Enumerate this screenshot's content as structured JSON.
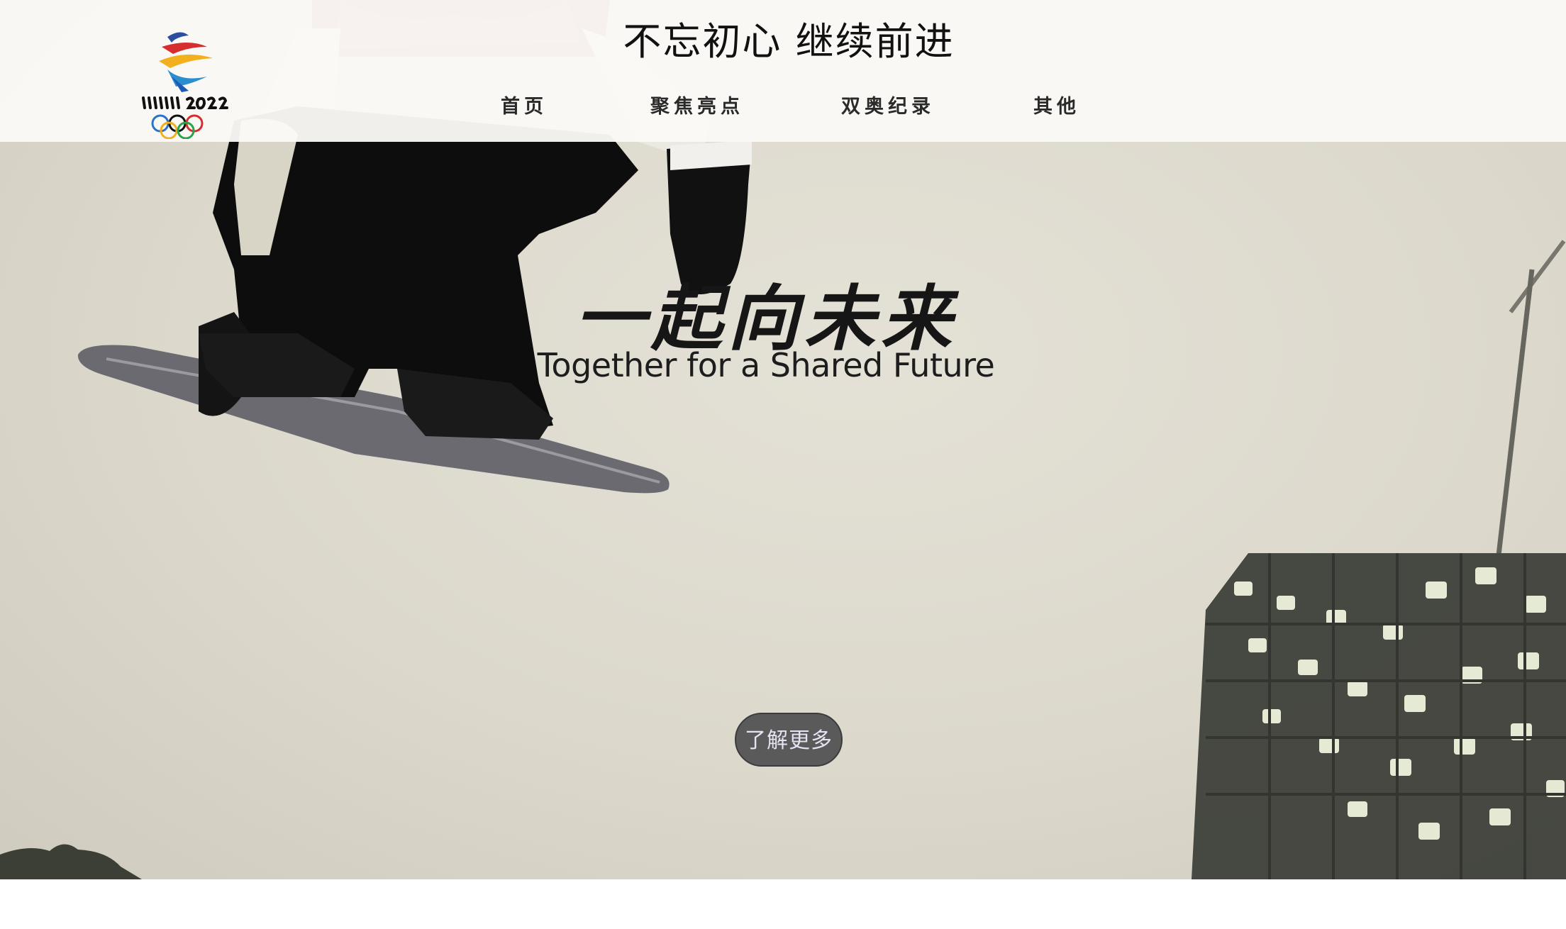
{
  "header": {
    "title": "不忘初心 继续前进",
    "logo_text": "BEIJING 2022"
  },
  "nav": {
    "items": [
      {
        "label": "首页"
      },
      {
        "label": "聚焦亮点"
      },
      {
        "label": "双奥纪录"
      },
      {
        "label": "其他"
      }
    ]
  },
  "hero": {
    "title": "一起向未来",
    "subtitle": "Together for a Shared Future",
    "cta_label": "了解更多"
  },
  "colors": {
    "header_bg": "#faf9f6",
    "hero_bg": "#dcd8cc",
    "cta_bg": "#5a5a5a",
    "cta_text": "#e6e2f2"
  },
  "icons": {
    "logo": "beijing-2022-emblem"
  }
}
